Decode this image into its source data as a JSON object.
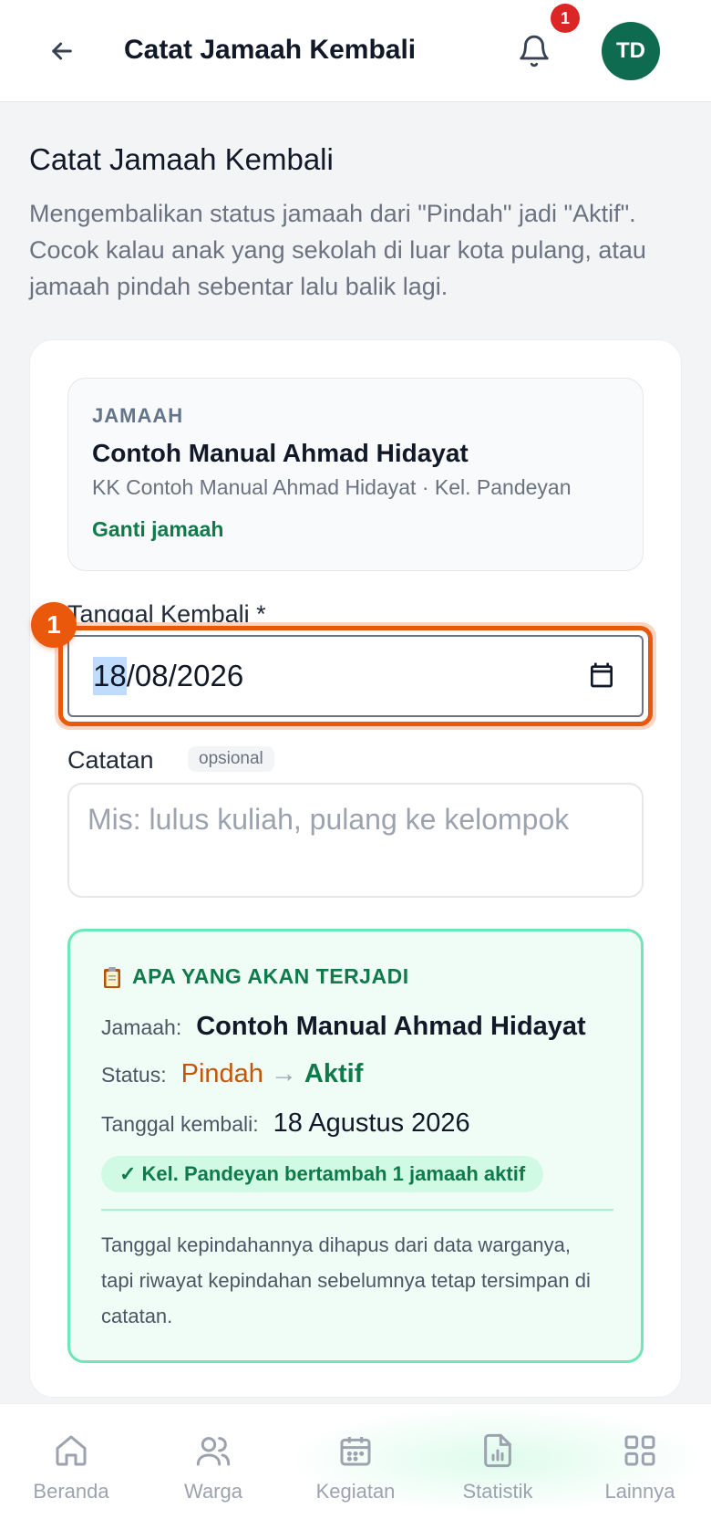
{
  "header": {
    "title": "Catat Jamaah Kembali",
    "notif_count": "1",
    "avatar_initials": "TD"
  },
  "intro": {
    "title": "Catat Jamaah Kembali",
    "description": "Mengembalikan status jamaah dari \"Pindah\" jadi \"Aktif\". Cocok kalau anak yang sekolah di luar kota pulang, atau jamaah pindah sebentar lalu balik lagi."
  },
  "jamaah": {
    "label": "JAMAAH",
    "name": "Contoh Manual Ahmad Hidayat",
    "kk": "KK Contoh Manual Ahmad Hidayat · Kel. Pandeyan",
    "change_link": "Ganti jamaah"
  },
  "form": {
    "date_label": "Tanggal Kembali *",
    "date_day": "18",
    "date_rest": "/08/2026",
    "step_number": "1",
    "note_label": "Catatan",
    "note_optional": "opsional",
    "note_placeholder": "Mis: lulus kuliah, pulang ke kelompok"
  },
  "preview": {
    "heading": "APA YANG AKAN TERJADI",
    "jamaah_key": "Jamaah:",
    "jamaah_val": "Contoh Manual Ahmad Hidayat",
    "status_key": "Status:",
    "status_from": "Pindah",
    "status_arrow": "→",
    "status_to": "Aktif",
    "date_key": "Tanggal kembali:",
    "date_val": "18 Agustus 2026",
    "pill": "✓ Kel. Pandeyan bertambah 1 jamaah aktif",
    "note": "Tanggal kepindahannya dihapus dari data warganya, tapi riwayat kepindahan sebelumnya tetap tersimpan di catatan."
  },
  "nav": {
    "items": [
      {
        "label": "Beranda",
        "icon": "home-icon"
      },
      {
        "label": "Warga",
        "icon": "users-icon"
      },
      {
        "label": "Kegiatan",
        "icon": "calendar-icon"
      },
      {
        "label": "Statistik",
        "icon": "chart-icon"
      },
      {
        "label": "Lainnya",
        "icon": "grid-icon"
      }
    ]
  },
  "colors": {
    "brand_green": "#0f7a4a",
    "avatar_bg": "#0f6b4f",
    "focus_orange": "#ea580c",
    "badge_red": "#dc2626"
  }
}
